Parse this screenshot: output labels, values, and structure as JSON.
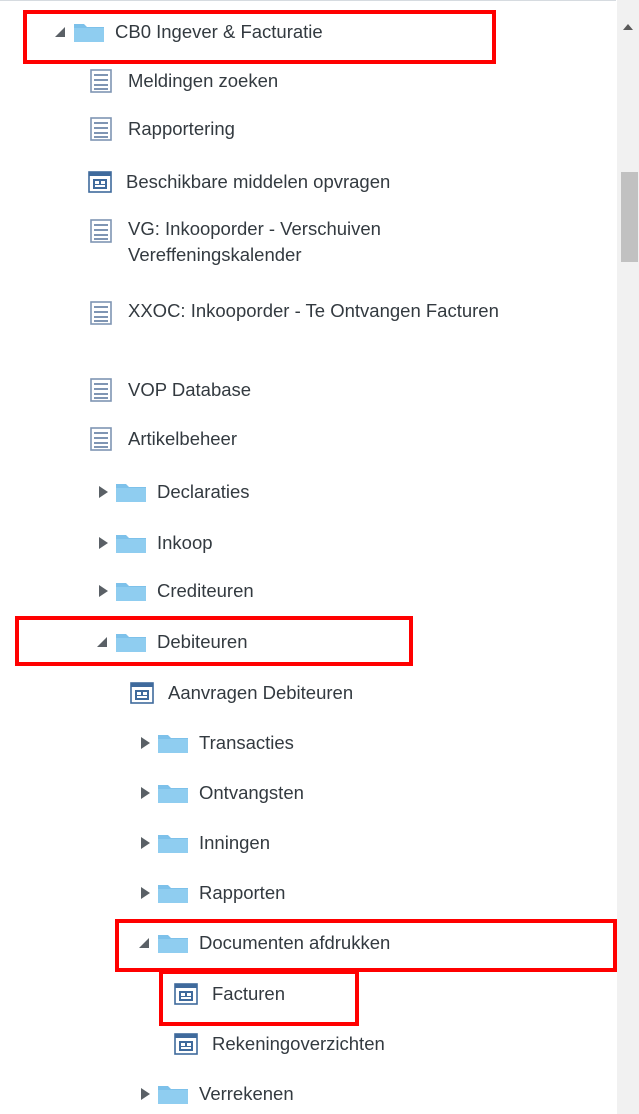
{
  "tree": {
    "root": {
      "label": "CB0 Ingever & Facturatie",
      "state": "expanded"
    },
    "items": [
      {
        "label": "Meldingen zoeken",
        "icon": "page-icon"
      },
      {
        "label": "Rapportering",
        "icon": "page-icon"
      },
      {
        "label": "Beschikbare middelen opvragen",
        "icon": "task-icon"
      },
      {
        "label": "VG: Inkooporder - Verschuiven Vereffeningskalender",
        "icon": "page-icon"
      },
      {
        "label": "XXOC: Inkooporder - Te Ontvangen Facturen",
        "icon": "page-icon"
      },
      {
        "label": "VOP Database",
        "icon": "page-icon"
      },
      {
        "label": "Artikelbeheer",
        "icon": "page-icon"
      },
      {
        "label": "Declaraties",
        "icon": "folder-icon",
        "state": "collapsed"
      },
      {
        "label": "Inkoop",
        "icon": "folder-icon",
        "state": "collapsed"
      },
      {
        "label": "Crediteuren",
        "icon": "folder-icon",
        "state": "collapsed"
      },
      {
        "label": "Debiteuren",
        "icon": "folder-icon",
        "state": "expanded"
      },
      {
        "label": "Aanvragen Debiteuren",
        "icon": "task-icon"
      },
      {
        "label": "Transacties",
        "icon": "folder-icon",
        "state": "collapsed"
      },
      {
        "label": "Ontvangsten",
        "icon": "folder-icon",
        "state": "collapsed"
      },
      {
        "label": "Inningen",
        "icon": "folder-icon",
        "state": "collapsed"
      },
      {
        "label": "Rapporten",
        "icon": "folder-icon",
        "state": "collapsed"
      },
      {
        "label": "Documenten afdrukken",
        "icon": "folder-icon",
        "state": "expanded"
      },
      {
        "label": "Facturen",
        "icon": "task-icon"
      },
      {
        "label": "Rekeningoverzichten",
        "icon": "task-icon"
      },
      {
        "label": "Verrekenen",
        "icon": "folder-icon",
        "state": "collapsed"
      }
    ]
  },
  "highlights": [
    "CB0 Ingever & Facturatie",
    "Debiteuren",
    "Documenten afdrukken",
    "Facturen"
  ],
  "colors": {
    "text": "#333a40",
    "folder": "#7dc1ea",
    "highlight": "#ff0000",
    "scrollbar_thumb": "#c1c1c1"
  }
}
